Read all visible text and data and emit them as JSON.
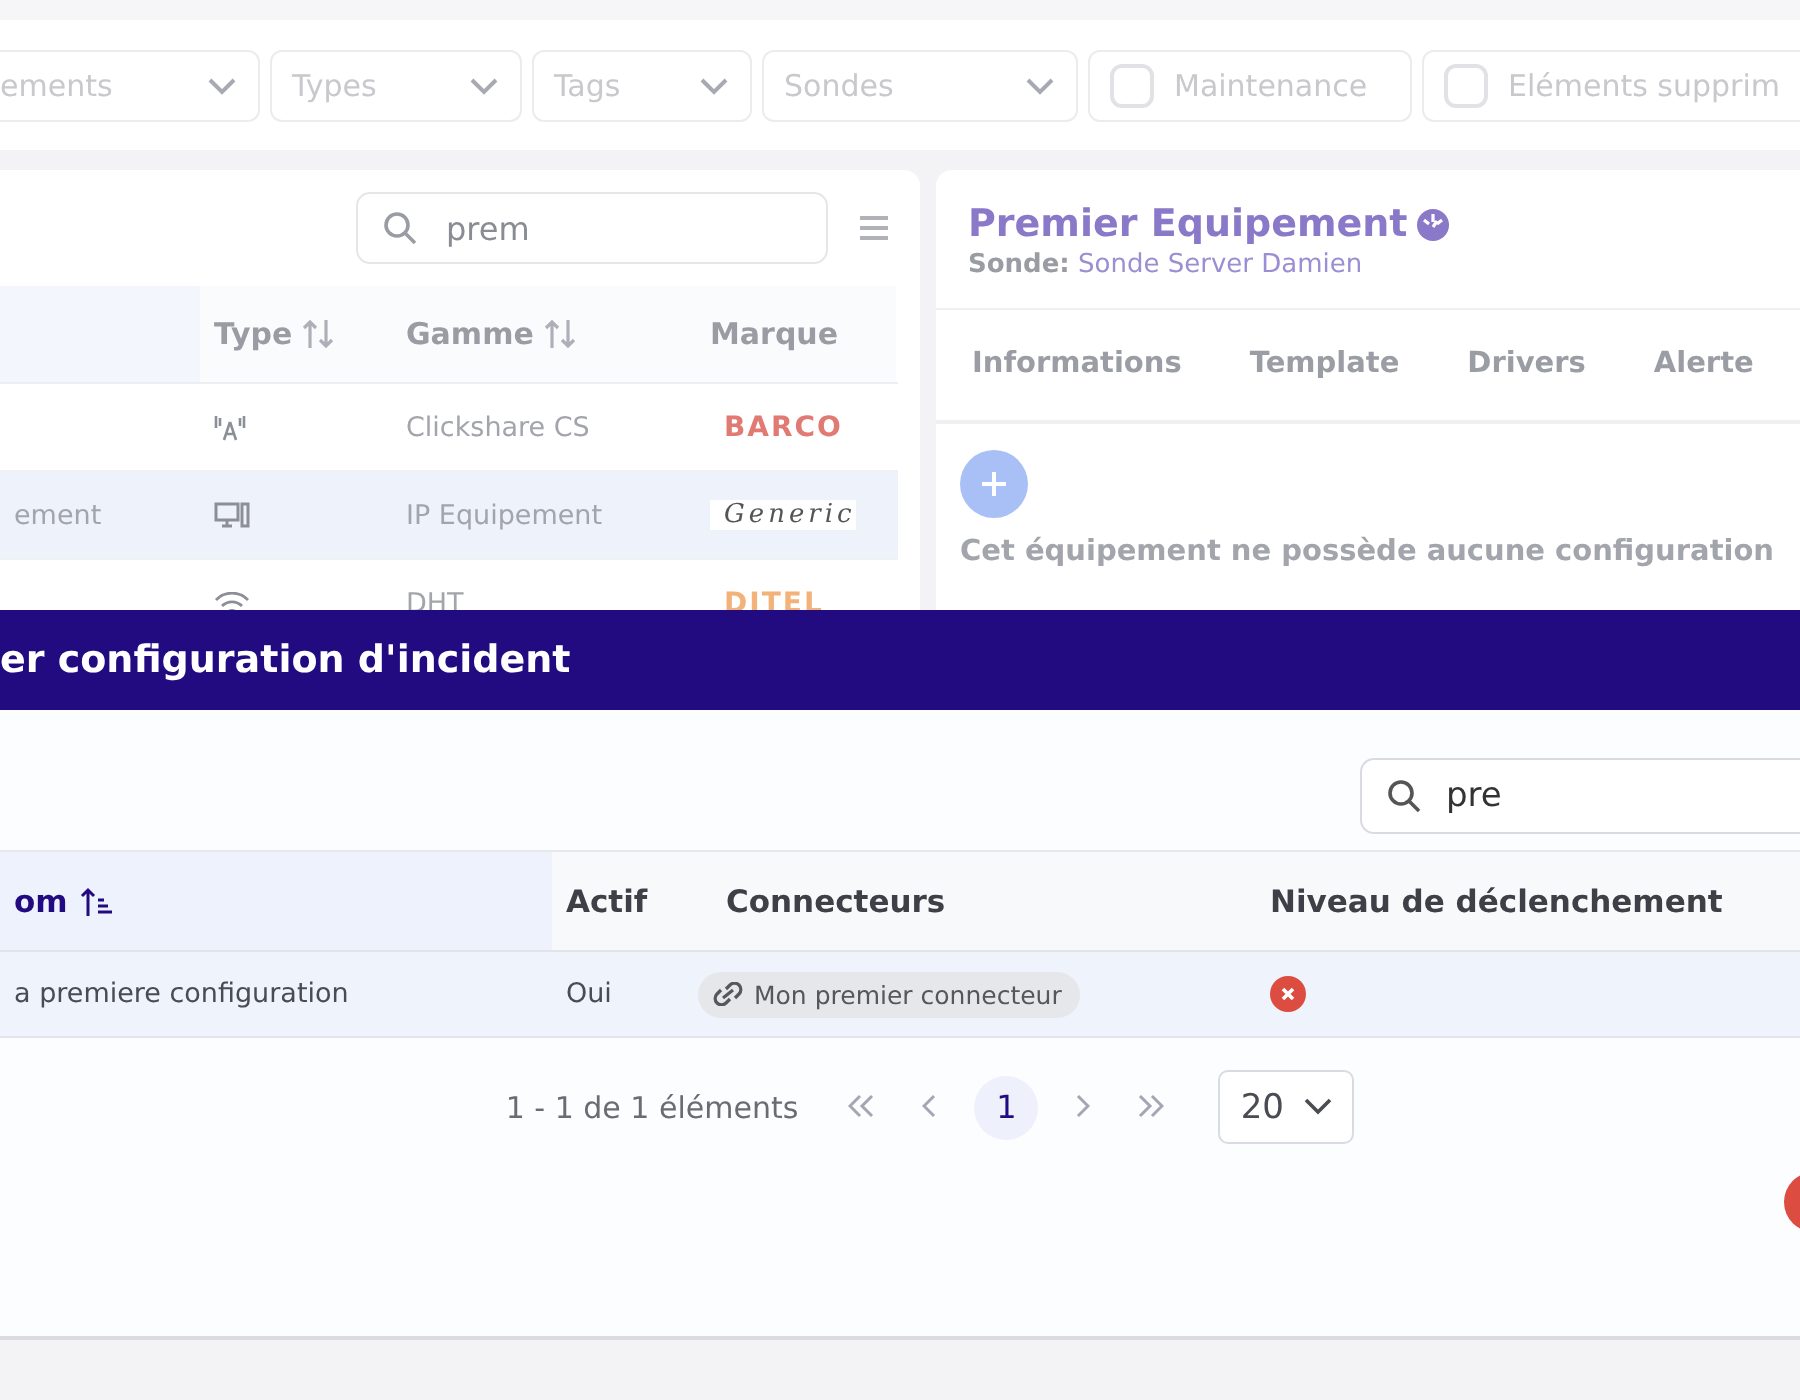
{
  "filters": [
    {
      "kind": "select",
      "label": "ements"
    },
    {
      "kind": "select",
      "label": "Types"
    },
    {
      "kind": "select",
      "label": "Tags"
    },
    {
      "kind": "select",
      "label": "Sondes"
    },
    {
      "kind": "checkbox",
      "label": "Maintenance",
      "checked": false
    },
    {
      "kind": "checkbox",
      "label": "Eléments supprim",
      "checked": false
    }
  ],
  "equipment_list": {
    "search": {
      "value": "prem"
    },
    "columns": [
      "Type",
      "Gamme",
      "Marque"
    ],
    "rows": [
      {
        "name": "",
        "kind": "antenna",
        "gamme": "Clickshare CS",
        "brand": {
          "kind": "barco",
          "text": "BARCO"
        },
        "selected": false
      },
      {
        "name": "ement",
        "kind": "computer",
        "gamme": "IP Equipement",
        "brand": {
          "kind": "generic",
          "text": "Generic"
        },
        "selected": true
      },
      {
        "name": "",
        "kind": "wifi",
        "gamme": "DHT",
        "brand": {
          "kind": "ditel",
          "text": "DITEL"
        },
        "selected": false
      }
    ]
  },
  "detail": {
    "title": "Premier Equipement",
    "probe_label": "Sonde:",
    "probe": "Sonde Server Damien",
    "tabs": [
      {
        "label": "Informations",
        "selected": false
      },
      {
        "label": "Template",
        "selected": false
      },
      {
        "label": "Drivers",
        "selected": false
      },
      {
        "label": "Alerte",
        "selected": false
      }
    ],
    "empty_message": "Cet équipement ne possède aucune configuration"
  },
  "modal": {
    "title": "er configuration d'incident",
    "search": {
      "value": "pre"
    },
    "columns": [
      {
        "label": "om",
        "sorted": true
      },
      {
        "label": "Actif",
        "sorted": false
      },
      {
        "label": "Connecteurs",
        "sorted": false
      },
      {
        "label": "Niveau de déclenchement",
        "sorted": false
      }
    ],
    "rows": [
      {
        "name": "a premiere configuration",
        "active": "Oui",
        "connector": "Mon premier connecteur",
        "triggered": false,
        "selected": true
      }
    ],
    "pagination": {
      "summary": "1 - 1 de 1 éléments",
      "pages": [
        {
          "label": "1",
          "selected": true
        }
      ],
      "page_size": "20"
    }
  }
}
